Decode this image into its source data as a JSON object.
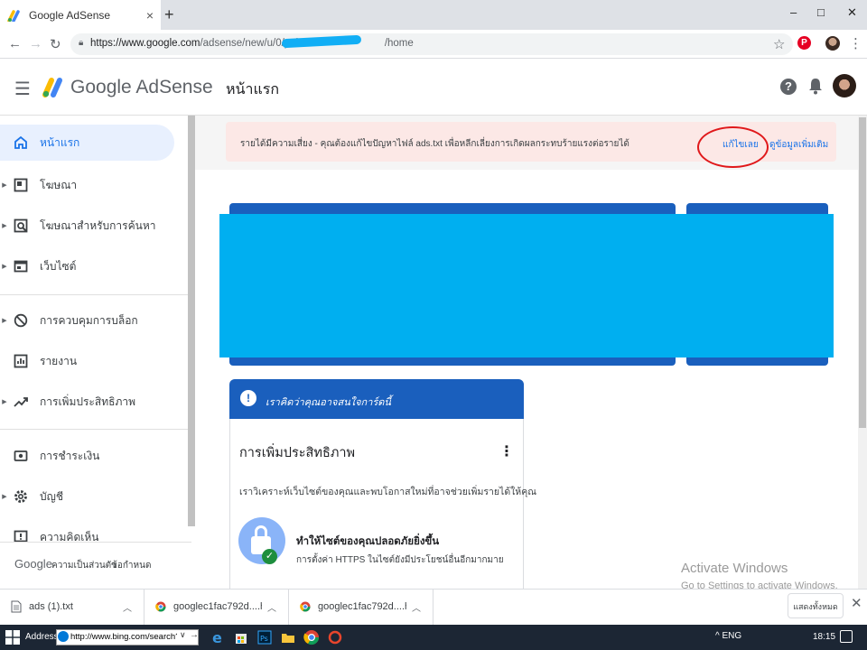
{
  "browser": {
    "tab_title": "Google AdSense",
    "tab_close": "×",
    "new_tab": "+",
    "url_main": "https://www.google.com",
    "url_path": "/adsense/new/u/0/pub-",
    "url_end": "/home",
    "win_min": "–",
    "win_max": "□",
    "win_close": "✕"
  },
  "header": {
    "brand": "Google AdSense",
    "page_title": "หน้าแรก"
  },
  "sidebar": {
    "items": [
      {
        "label": "หน้าแรก",
        "icon": "home-icon"
      },
      {
        "label": "โฆษณา",
        "icon": "ads-icon"
      },
      {
        "label": "โฆษณาสำหรับการค้นหา",
        "icon": "search-ads-icon"
      },
      {
        "label": "เว็บไซต์",
        "icon": "sites-icon"
      },
      {
        "label": "การควบคุมการบล็อก",
        "icon": "block-icon"
      },
      {
        "label": "รายงาน",
        "icon": "reports-icon"
      },
      {
        "label": "การเพิ่มประสิทธิภาพ",
        "icon": "optimization-icon"
      },
      {
        "label": "การชำระเงิน",
        "icon": "payments-icon"
      },
      {
        "label": "บัญชี",
        "icon": "account-gear-icon"
      },
      {
        "label": "ความคิดเห็น",
        "icon": "feedback-icon"
      }
    ],
    "footer_brand": "Google",
    "footer_privacy": "ความเป็นส่วนตัว",
    "footer_terms": "ข้อกำหนด"
  },
  "alert": {
    "text": "รายได้มีความเสี่ยง - คุณต้องแก้ไขปัญหาไฟล์ ads.txt เพื่อหลีกเลี่ยงการเกิดผลกระทบร้ายแรงต่อรายได้",
    "fix_label": "แก้ไขเลย",
    "more_label": "ดูข้อมูลเพิ่มเติม"
  },
  "opportunity_card": {
    "header": "เราคิดว่าคุณอาจสนใจการ์ดนี้",
    "title": "การเพิ่มประสิทธิภาพ",
    "description": "เราวิเคราะห์เว็บไซต์ของคุณและพบโอกาสใหม่ที่อาจช่วยเพิ่มรายได้ให้คุณ",
    "item_title": "ทำให้ไซต์ของคุณปลอดภัยยิ่งขึ้น",
    "item_text": "การตั้งค่า HTTPS ในไซต์ยังมีประโยชน์อื่นอีกมากมาย"
  },
  "watermark": {
    "line1": "Activate Windows",
    "line2": "Go to Settings to activate Windows."
  },
  "downloads": {
    "items": [
      "ads (1).txt",
      "googlec1fac792d....html",
      "googlec1fac792d....html"
    ],
    "show_all": "แสดงทั้งหมด",
    "close": "✕"
  },
  "taskbar": {
    "address_label": "Address",
    "address_value": "http://www.bing.com/search?c",
    "tray": "^  ENG",
    "time": "18:15"
  },
  "colors": {
    "adsense_blue": "#1a5fbd",
    "redaction": "#00aff0",
    "alert_bg": "#fce8e6",
    "annotation_circle": "#e0181a"
  }
}
